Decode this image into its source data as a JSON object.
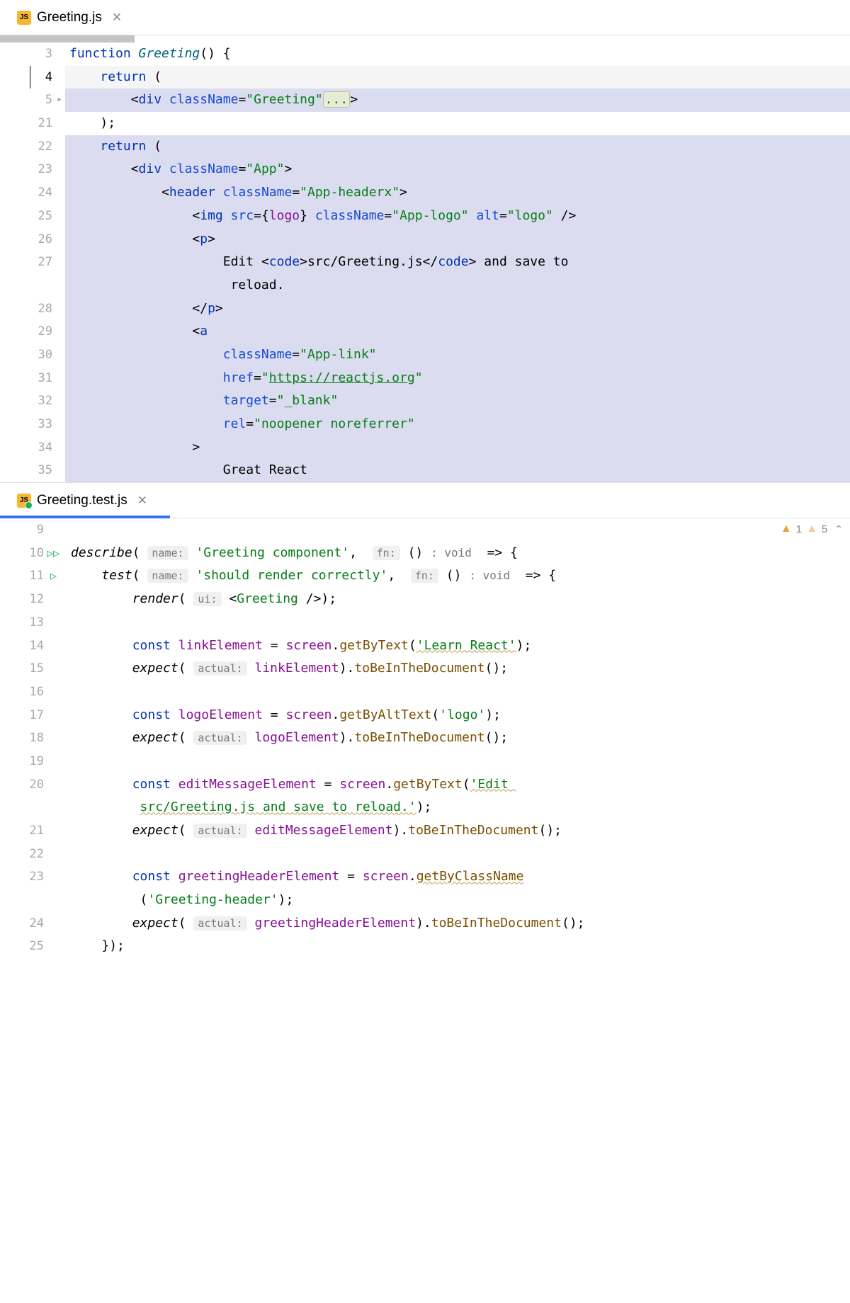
{
  "panes": {
    "top": {
      "tab": {
        "filename": "Greeting.js",
        "has_test_badge": false
      },
      "gutter_numbers": [
        "3",
        "4",
        "5",
        "21",
        "22",
        "23",
        "24",
        "25",
        "26",
        "27",
        "",
        "28",
        "29",
        "30",
        "31",
        "32",
        "33",
        "34",
        "35"
      ],
      "fold_at_line": "5",
      "current_line": "4",
      "code": {
        "l3": {
          "kw": "function",
          "name": "Greeting",
          "rest": "() {"
        },
        "l4": {
          "kw": "return",
          "rest": " ("
        },
        "l5": {
          "tag": "div",
          "attr": "className",
          "val": "\"Greeting\"",
          "fold": "...",
          "close": ">"
        },
        "l21": ");",
        "l22": {
          "kw": "return",
          "rest": " ("
        },
        "l23": {
          "tag": "div",
          "attr": "className",
          "val": "\"App\"",
          "close": ">"
        },
        "l24": {
          "tag": "header",
          "attr": "className",
          "val": "\"App-headerx\"",
          "close": ">"
        },
        "l25": {
          "tag": "img",
          "attrs": "src={logo} className=\"App-logo\" alt=\"logo\"",
          "close": " />"
        },
        "l26": {
          "tag": "p",
          "close": ">"
        },
        "l27a": "Edit ",
        "l27_code_open": "code",
        "l27_code_text": "src/Greeting.js",
        "l27b": " and save to",
        "l27c": " reload.",
        "l28": {
          "tag": "p"
        },
        "l29": {
          "tag": "a"
        },
        "l30": {
          "attr": "className",
          "val": "\"App-link\""
        },
        "l31": {
          "attr": "href",
          "val": "\"https://reactjs.org\""
        },
        "l32": {
          "attr": "target",
          "val": "\"_blank\""
        },
        "l33": {
          "attr": "rel",
          "val": "\"noopener noreferrer\""
        },
        "l34": ">",
        "l35": "Great React"
      }
    },
    "bottom": {
      "tab": {
        "filename": "Greeting.test.js",
        "has_test_badge": true
      },
      "warnings": {
        "count1": "1",
        "count2": "5"
      },
      "gutter_numbers": [
        "9",
        "10",
        "11",
        "12",
        "13",
        "14",
        "15",
        "16",
        "17",
        "18",
        "19",
        "20",
        "",
        "21",
        "22",
        "23",
        "",
        "24",
        "25"
      ],
      "run_markers": {
        "10": "double",
        "11": "single"
      },
      "code": {
        "l10": {
          "fn": "describe",
          "hint1": "name:",
          "str1": "'Greeting component'",
          "hint2": "fn:",
          "rest": "() ",
          "type": ": void",
          "arrow": "  => {"
        },
        "l11": {
          "fn": "test",
          "hint1": "name:",
          "str1": "'should render correctly'",
          "hint2": "fn:",
          "rest": "() ",
          "type": ": void",
          "arrow": "  => {"
        },
        "l12": {
          "fn": "render",
          "hint": "ui:",
          "jsx": "<Greeting />",
          "rest": ");"
        },
        "l14": {
          "kw": "const",
          "var": "linkElement",
          "obj": "screen",
          "method": "getByText",
          "arg": "'Learn React'"
        },
        "l15": {
          "fn": "expect",
          "hint": "actual:",
          "var": "linkElement",
          "method": "toBeInTheDocument"
        },
        "l17": {
          "kw": "const",
          "var": "logoElement",
          "obj": "screen",
          "method": "getByAltText",
          "arg": "'logo'"
        },
        "l18": {
          "fn": "expect",
          "hint": "actual:",
          "var": "logoElement",
          "method": "toBeInTheDocument"
        },
        "l20": {
          "kw": "const",
          "var": "editMessageElement",
          "obj": "screen",
          "method": "getByText",
          "arg": "'Edit "
        },
        "l20b": "src/Greeting.js and save to reload.'",
        "l21": {
          "fn": "expect",
          "hint": "actual:",
          "var": "editMessageElement",
          "method": "toBeInTheDocument"
        },
        "l23": {
          "kw": "const",
          "var": "greetingHeaderElement",
          "obj": "screen",
          "method": "getByClassName"
        },
        "l23b": "'Greeting-header'",
        "l24": {
          "fn": "expect",
          "hint": "actual:",
          "var": "greetingHeaderElement",
          "method": "toBeInTheDocument"
        },
        "l25": "});"
      }
    }
  }
}
